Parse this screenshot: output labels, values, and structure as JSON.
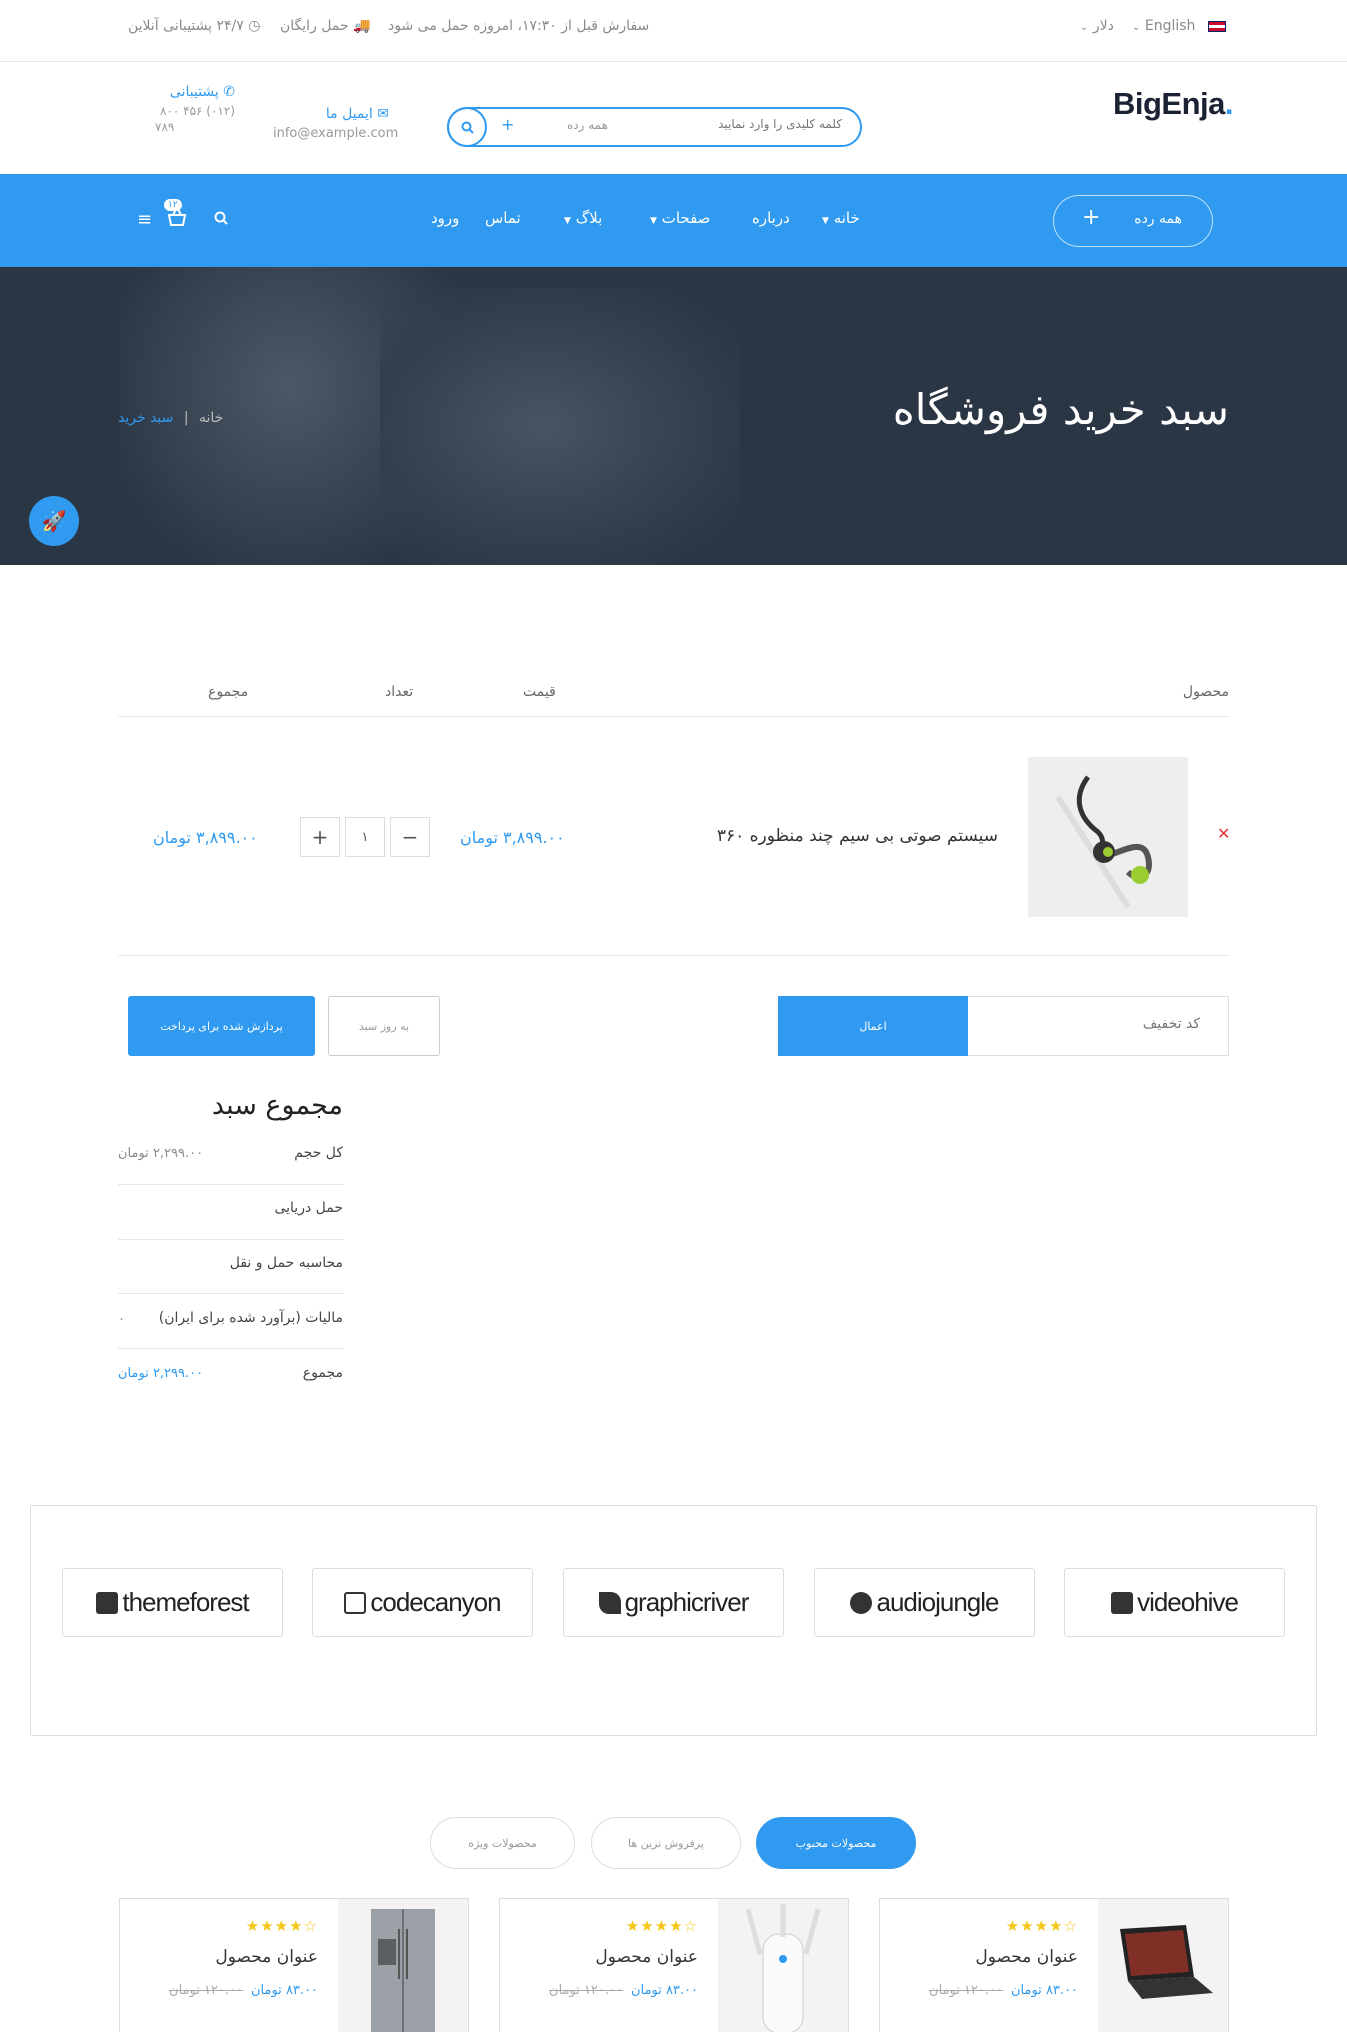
{
  "topbar": {
    "language": "English",
    "currency": "دلار",
    "order_notice": "سفارش قبل از ۱۷:۳۰، امروزه حمل می شود",
    "free_shipping": "حمل رایگان",
    "support_247": "۲۴/۷ پشتیبانی آنلاین"
  },
  "header": {
    "logo": "BigEnja",
    "logo_dot": ".",
    "search_placeholder": "کلمه کلیدی را وارد نمایید",
    "search_category": "همه رده",
    "email_label": "ایمیل ما",
    "email_value": "info@example.com",
    "support_label": "پشتیبانی",
    "support_phone_1": "(۰۱۲) ۴۵۶ ۸۰۰",
    "support_phone_2": "۷۸۹"
  },
  "nav": {
    "all_categories": "همه رده",
    "items": [
      "خانه",
      "درباره",
      "صفحات",
      "بلاگ",
      "تماس",
      "ورود"
    ],
    "cart_count": "۱۲"
  },
  "hero": {
    "title": "سبد خرید فروشگاه",
    "breadcrumb_home": "خانه",
    "breadcrumb_sep": "|",
    "breadcrumb_current": "سبد خرید"
  },
  "cart": {
    "headers": {
      "product": "محصول",
      "price": "قیمت",
      "quantity": "تعداد",
      "total": "مجموع"
    },
    "item": {
      "name": "سیستم صوتی بی سیم چند منظوره ۳۶۰",
      "price": "۳,۸۹۹.۰۰ تومان",
      "quantity": "۱",
      "total": "۳,۸۹۹.۰۰ تومان"
    },
    "coupon_placeholder": "کد تخفیف",
    "apply_label": "اعمال",
    "update_label": "به روز سبد",
    "checkout_label": "پردازش شده برای پرداخت"
  },
  "totals": {
    "title": "مجموع سبد",
    "rows": [
      {
        "label": "کل حجم",
        "value": "۲,۲۹۹.۰۰ تومان"
      },
      {
        "label": "حمل دریایی",
        "value": ""
      },
      {
        "label": "محاسبه حمل و نقل",
        "value": ""
      },
      {
        "label": "مالیات (برآورد شده برای ایران)",
        "value": "۰"
      },
      {
        "label": "مجموع",
        "value": "۲,۲۹۹.۰۰ تومان"
      }
    ]
  },
  "brands": [
    "themeforest",
    "codecanyon",
    "graphicriver",
    "audiojungle",
    "videohive"
  ],
  "product_tabs": [
    "محصولات محبوب",
    "پرفروش ترین ها",
    "محصولات ویژه"
  ],
  "products": [
    {
      "title": "عنوان محصول",
      "price": "۸۳.۰۰ تومان",
      "old_price": "۱۲۰.۰۰ تومان",
      "image": "laptop"
    },
    {
      "title": "عنوان محصول",
      "price": "۸۳.۰۰ تومان",
      "old_price": "۱۲۰.۰۰ تومان",
      "image": "router"
    },
    {
      "title": "عنوان محصول",
      "price": "۸۳.۰۰ تومان",
      "old_price": "۱۲۰.۰۰ تومان",
      "image": "fridge"
    }
  ],
  "colors": {
    "accent": "#2f9af0",
    "hero_bg": "#2b3645",
    "remove": "#e8343c",
    "star": "#f5c518"
  }
}
